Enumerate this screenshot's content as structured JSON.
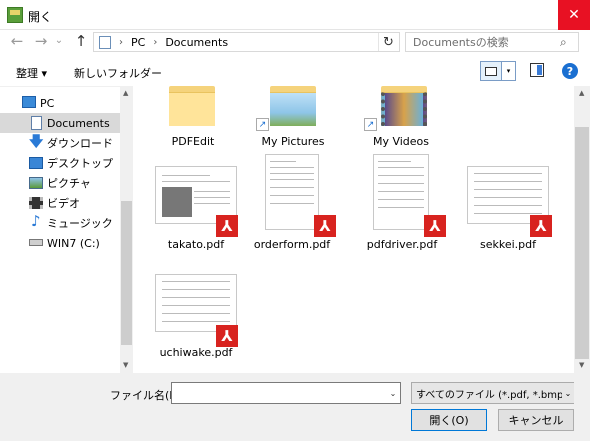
{
  "window": {
    "title": "開く",
    "close_glyph": "✕"
  },
  "nav": {
    "back_glyph": "←",
    "forward_glyph": "→",
    "recent_glyph": "⌄",
    "up_glyph": "↑",
    "breadcrumb": [
      "PC",
      "Documents"
    ],
    "separator": "›",
    "refresh_glyph": "↻",
    "search_placeholder": "Documentsの検索"
  },
  "toolbar": {
    "organize_label": "整理 ▾",
    "new_folder_label": "新しいフォルダー",
    "view_dd_glyph": "▾",
    "help_label": "?"
  },
  "navpane": {
    "items": [
      {
        "label": "PC",
        "icon": "pc-icon"
      },
      {
        "label": "Documents",
        "icon": "documents-icon",
        "selected": true
      },
      {
        "label": "ダウンロード",
        "icon": "download-icon"
      },
      {
        "label": "デスクトップ",
        "icon": "desktop-icon"
      },
      {
        "label": "ピクチャ",
        "icon": "pictures-icon"
      },
      {
        "label": "ビデオ",
        "icon": "video-icon"
      },
      {
        "label": "ミュージック",
        "icon": "music-icon"
      },
      {
        "label": "WIN7 (C:)",
        "icon": "drive-icon"
      }
    ]
  },
  "files": [
    {
      "name": "PDFEdit",
      "kind": "folder"
    },
    {
      "name": "My Pictures",
      "kind": "folder-shortcut"
    },
    {
      "name": "My Videos",
      "kind": "folder-shortcut"
    },
    {
      "name": "takato.pdf",
      "kind": "pdf"
    },
    {
      "name": "orderform.pdf",
      "kind": "pdf"
    },
    {
      "name": "pdfdriver.pdf",
      "kind": "pdf"
    },
    {
      "name": "sekkei.pdf",
      "kind": "pdf"
    },
    {
      "name": "uchiwake.pdf",
      "kind": "pdf"
    }
  ],
  "footer": {
    "filename_label": "ファイル名(N):",
    "filename_value": "",
    "filetype_value": "すべてのファイル (*.pdf, *.bmp, *.jp",
    "open_label": "開く(O)",
    "cancel_label": "キャンセル",
    "dropdown_glyph": "⌄"
  },
  "colors": {
    "close": "#e81123",
    "accent": "#0078d7",
    "pdf_badge": "#d8231f",
    "folder": "#ffe49a",
    "selected": "#d9d9d9"
  }
}
